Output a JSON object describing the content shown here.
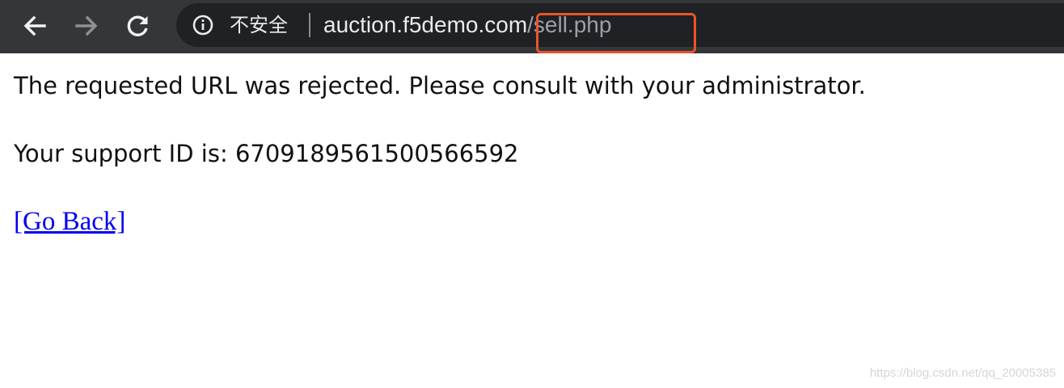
{
  "browser": {
    "security_label": "不安全",
    "url_host": "auction.f5demo.com",
    "url_path": "/sell.php",
    "icons": {
      "back": "back-arrow-icon",
      "forward": "forward-arrow-icon",
      "reload": "reload-icon",
      "info": "info-icon"
    },
    "highlight_color": "#e8542e",
    "toolbar_color": "#35363a",
    "omnibox_color": "#202124"
  },
  "page": {
    "message": "The requested URL was rejected. Please consult with your administrator.",
    "support_line": "Your support ID is: 6709189561500566592",
    "back_link": "[Go Back]",
    "link_color": "#0000ee"
  },
  "watermark": "https://blog.csdn.net/qq_20005385"
}
